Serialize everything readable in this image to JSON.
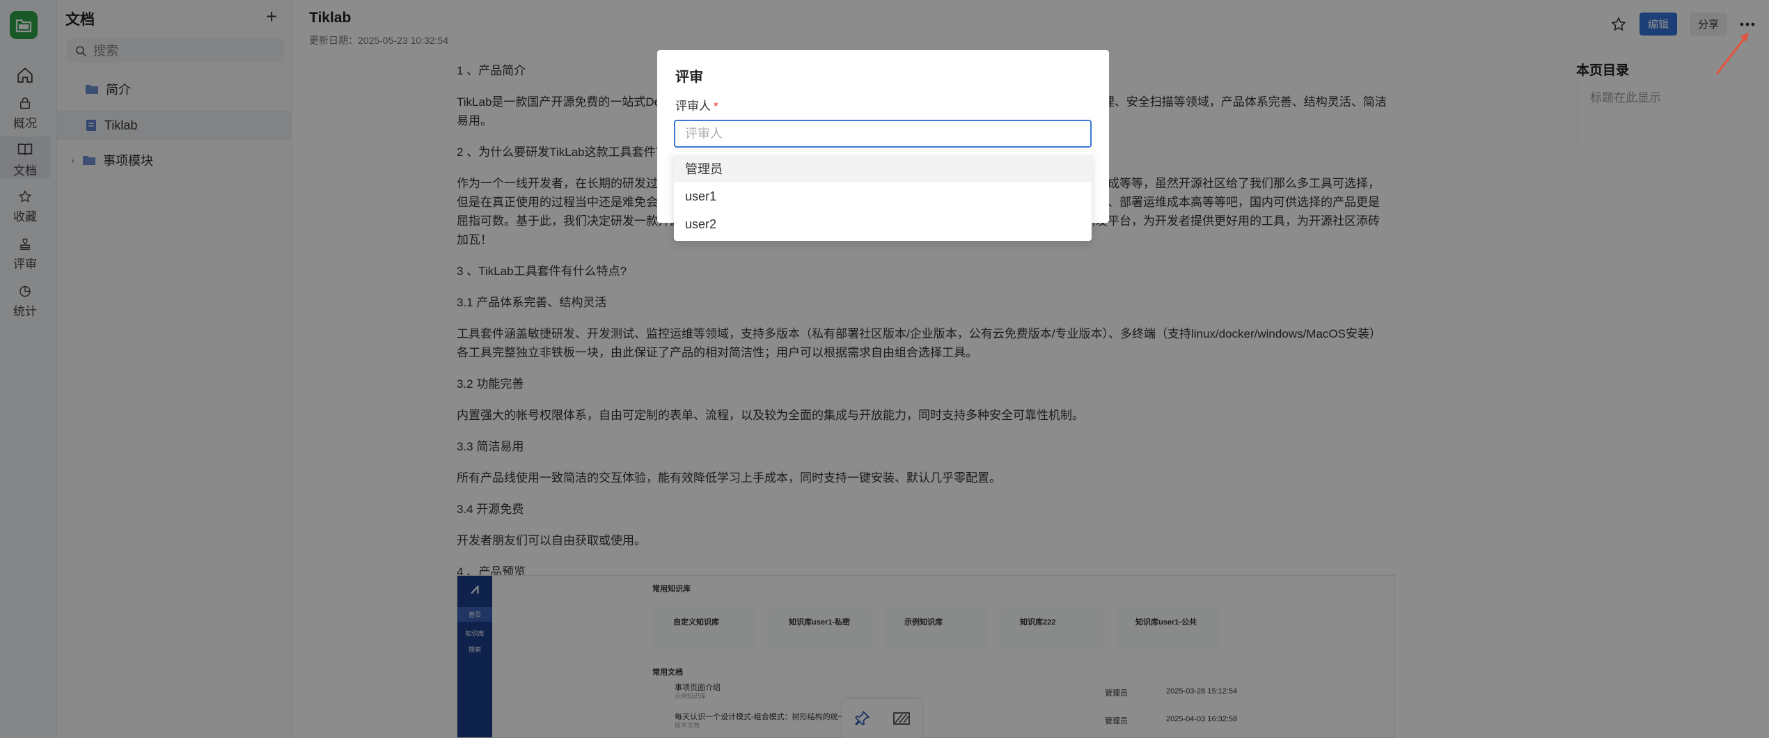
{
  "sidebar_rail": {
    "items": [
      {
        "label": "",
        "icon": "home-icon"
      },
      {
        "label": "概况",
        "icon": "overview-icon"
      },
      {
        "label": "文档",
        "icon": "docs-icon"
      },
      {
        "label": "收藏",
        "icon": "star-icon"
      },
      {
        "label": "评审",
        "icon": "review-icon"
      },
      {
        "label": "统计",
        "icon": "stats-icon"
      }
    ]
  },
  "tree": {
    "title": "文档",
    "search_placeholder": "搜索",
    "nodes": [
      {
        "label": "简介",
        "icon": "folder-icon"
      },
      {
        "label": "Tiklab",
        "icon": "document-icon"
      },
      {
        "label": "事项模块",
        "icon": "folder-icon"
      }
    ]
  },
  "header": {
    "title": "Tiklab",
    "updated": "更新日期：2025-05-23 10:32:54",
    "edit_label": "编辑",
    "share_label": "分享"
  },
  "toc": {
    "title": "本页目录",
    "empty": "标题在此显示"
  },
  "content": {
    "p1": "1 、产品简介",
    "p2": "TikLab是一款国产开源免费的一站式DevOps研发平台，覆盖项目管理、知识管理、测试管理、代码托管、持续集成、制品管理、安全扫描等领域，产品体系完善、结构灵活、简洁易用。",
    "p3": "2 、为什么要研发TikLab这款工具套件？",
    "p4": "作为一个一线开发者，在长期的研发过程中，我们使用了很多工具，包括项目管理、知识管理、测试管理、代码托管、持续集成等等，虽然开源社区给了我们那么多工具可选择，但是在真正使用的过程当中还是难免会发现有各种各样的问题，比如工具之间无法统一账号、数据不互通、功能复杂难以上手、部署运维成本高等等吧，国内可供选择的产品更是屈指可数。基于此，我们决定研发一款开源的全家桶研发工具套件，让广大开发者朋友们能够以零成本的方式使用一站式研发平台，为开发者提供更好用的工具，为开源社区添砖加瓦！",
    "p5": "3 、TikLab工具套件有什么特点?",
    "p6": " 3.1 产品体系完善、结构灵活",
    "p7": "工具套件涵盖敏捷研发、开发测试、监控运维等领域，支持多版本（私有部署社区版本/企业版本，公有云免费版本/专业版本）、多终端（支持linux/docker/windows/MacOS安装）各工具完整独立非铁板一块，由此保证了产品的相对简洁性；用户可以根据需求自由组合选择工具。",
    "p8": "3.2 功能完善",
    "p9": "内置强大的帐号权限体系，自由可定制的表单、流程，以及较为全面的集成与开放能力，同时支持多种安全可靠性机制。",
    "p10": "3.3 简洁易用",
    "p11": "所有产品线使用一致简洁的交互体验，能有效降低学习上手成本，同时支持一键安装、默认几乎零配置。",
    "p12": "3.4 开源免费",
    "p13": "开发者朋友们可以自由获取或使用。",
    "p14": "4 、产品预览"
  },
  "preview": {
    "nav": [
      "首页",
      "知识库",
      "搜索"
    ],
    "section1": "常用知识库",
    "cards": [
      "自定义知识库",
      "知识库user1-私密",
      "示例知识库",
      "知识库222",
      "知识库user1-公共"
    ],
    "section2": "常用文档",
    "docs": [
      {
        "name": "事项页面介绍",
        "sub": "示例知识库",
        "user": "管理员",
        "time": "2025-03-28 15:12:54"
      },
      {
        "name": "每天认识一个设计模式-组合模式：树形结构的统一接口艺术",
        "sub": "技术文档",
        "user": "管理员",
        "time": "2025-04-03 16:32:58"
      }
    ]
  },
  "modal": {
    "title": "评审",
    "field_label": "评审人",
    "required_mark": "*",
    "placeholder": "评审人",
    "options": [
      "管理员",
      "user1",
      "user2"
    ]
  },
  "colors": {
    "brand_green": "#2ea34a",
    "primary_blue": "#3273d8",
    "arrow_red": "#e8513a"
  }
}
